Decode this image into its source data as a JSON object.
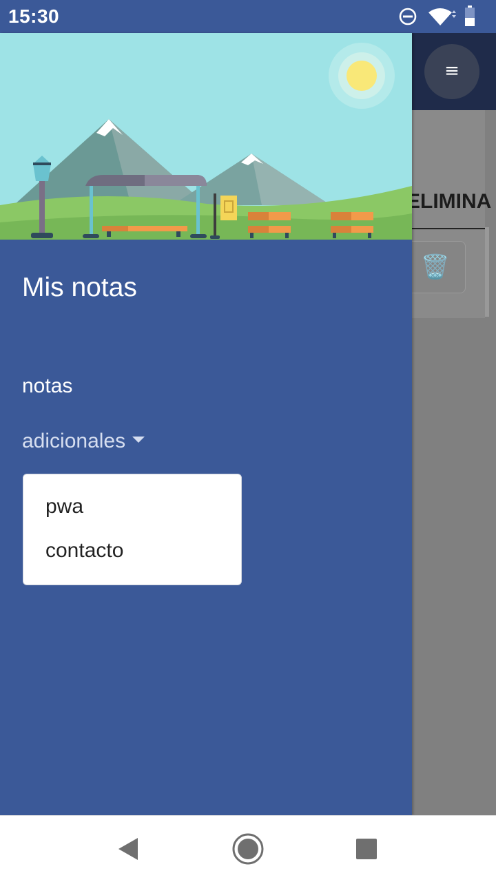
{
  "status_bar": {
    "time": "15:30",
    "icons": [
      "do-not-disturb-icon",
      "wifi-icon",
      "battery-icon"
    ]
  },
  "app": {
    "menu_glyph": "≡",
    "tab_label": "ELIMINA",
    "trash_glyph": "🗑️"
  },
  "drawer": {
    "title": "Mis notas",
    "nav": {
      "notas": "notas",
      "adicionales": "adicionales"
    },
    "dropdown": {
      "items": [
        "pwa",
        "contacto"
      ]
    }
  },
  "colors": {
    "primary": "#3b5998",
    "header_dark": "#1f2b4a",
    "scrim": "#808080"
  }
}
